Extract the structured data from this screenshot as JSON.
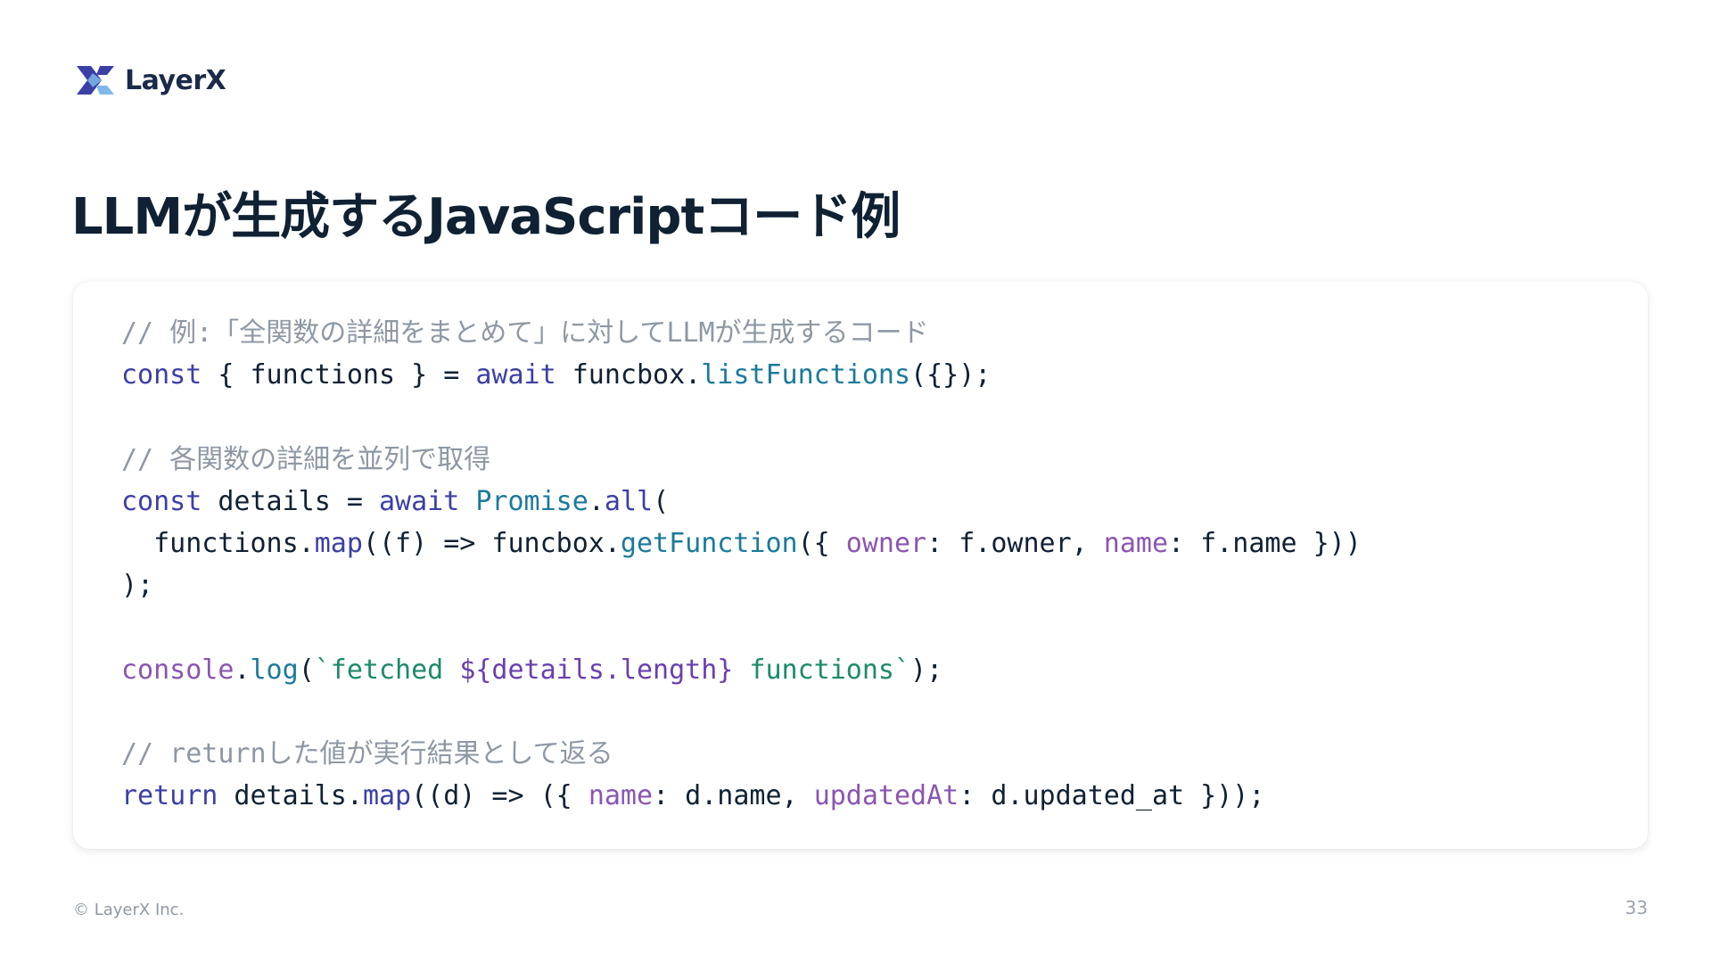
{
  "brand": {
    "name": "LayerX",
    "logo_icon": "layerx-logo-icon",
    "colors": {
      "primary": "#3b3fa6",
      "light": "#7fb8ea"
    }
  },
  "slide": {
    "title": "LLMが生成するJavaScriptコード例",
    "page_number": "33",
    "footer": "© LayerX Inc."
  },
  "code": {
    "lines": [
      [
        {
          "text": "// 例:「全関数の詳細をまとめて」に対してLLMが生成するコード",
          "type": "comment"
        }
      ],
      [
        {
          "text": "const",
          "type": "kw"
        },
        {
          "text": " { functions } = ",
          "type": "plain"
        },
        {
          "text": "await",
          "type": "kw"
        },
        {
          "text": " funcbox.",
          "type": "plain"
        },
        {
          "text": "listFunctions",
          "type": "fn"
        },
        {
          "text": "({});",
          "type": "plain"
        }
      ],
      [],
      [
        {
          "text": "// 各関数の詳細を並列で取得",
          "type": "comment"
        }
      ],
      [
        {
          "text": "const",
          "type": "kw"
        },
        {
          "text": " details = ",
          "type": "plain"
        },
        {
          "text": "await",
          "type": "kw"
        },
        {
          "text": " ",
          "type": "plain"
        },
        {
          "text": "Promise",
          "type": "fn"
        },
        {
          "text": ".",
          "type": "plain"
        },
        {
          "text": "all",
          "type": "kw"
        },
        {
          "text": "(",
          "type": "plain"
        }
      ],
      [
        {
          "text": "  functions.",
          "type": "plain"
        },
        {
          "text": "map",
          "type": "kw"
        },
        {
          "text": "((f) => funcbox.",
          "type": "plain"
        },
        {
          "text": "getFunction",
          "type": "fn"
        },
        {
          "text": "({ ",
          "type": "plain"
        },
        {
          "text": "owner",
          "type": "prop"
        },
        {
          "text": ": f.owner, ",
          "type": "plain"
        },
        {
          "text": "name",
          "type": "prop"
        },
        {
          "text": ": f.name }))",
          "type": "plain"
        }
      ],
      [
        {
          "text": ");",
          "type": "plain"
        }
      ],
      [],
      [
        {
          "text": "console",
          "type": "obj"
        },
        {
          "text": ".",
          "type": "plain"
        },
        {
          "text": "log",
          "type": "fn"
        },
        {
          "text": "(",
          "type": "plain"
        },
        {
          "text": "`fetched ",
          "type": "str"
        },
        {
          "text": "${details.length}",
          "type": "interp"
        },
        {
          "text": " functions`",
          "type": "str"
        },
        {
          "text": ");",
          "type": "plain"
        }
      ],
      [],
      [
        {
          "text": "// returnした値が実行結果として返る",
          "type": "comment"
        }
      ],
      [
        {
          "text": "return",
          "type": "kw"
        },
        {
          "text": " details.",
          "type": "plain"
        },
        {
          "text": "map",
          "type": "kw"
        },
        {
          "text": "((d) => ({ ",
          "type": "plain"
        },
        {
          "text": "name",
          "type": "prop"
        },
        {
          "text": ": d.name, ",
          "type": "plain"
        },
        {
          "text": "updatedAt",
          "type": "prop"
        },
        {
          "text": ": d.updated_at }));",
          "type": "plain"
        }
      ]
    ]
  }
}
